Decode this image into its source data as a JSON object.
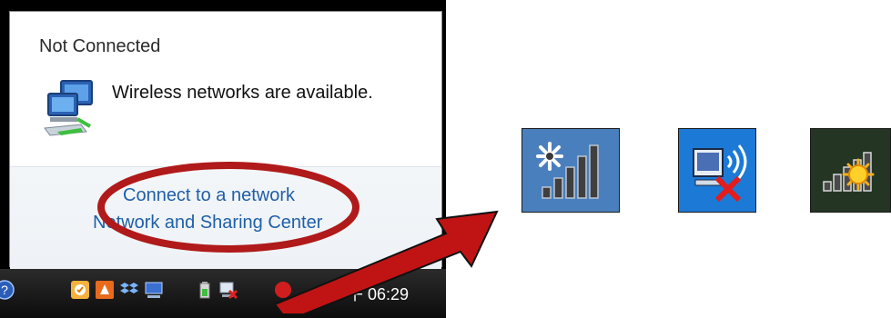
{
  "popup": {
    "status_title": "Not Connected",
    "wireless_message": "Wireless networks are available.",
    "connect_link": "Connect to a network",
    "sharing_link": "Network and Sharing Center",
    "icon": "network-computers-icon"
  },
  "taskbar": {
    "clock": "下午 06:29",
    "tray_icons": [
      "help-icon",
      "outlook-icon",
      "ppstream-icon",
      "dropbox-icon",
      "display-icon",
      "power-icon",
      "network-disconnected-icon",
      "antivirus-icon"
    ]
  },
  "status_icons": [
    {
      "name": "wireless-searching-icon",
      "bg": "#4a7fbd"
    },
    {
      "name": "wireless-disconnected-icon",
      "bg": "#1c7ad6"
    },
    {
      "name": "wireless-limited-icon",
      "bg": "#243524"
    }
  ],
  "colors": {
    "link": "#1f5fa9",
    "highlight": "#b01a1a",
    "arrow": "#c01414"
  }
}
